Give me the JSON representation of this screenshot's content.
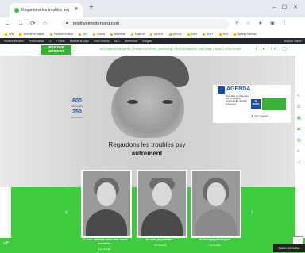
{
  "browser": {
    "tab_title": "Regardons les troubles psy au...",
    "tab_close": "×",
    "new_tab": "+",
    "window_buttons": "– ☐ ✕",
    "nav": {
      "back": "←",
      "forward": "→",
      "reload": "⟳",
      "home": "⌂"
    },
    "url": "positivemindersorg.com",
    "toolbar_icons": "⚲ ☆ ★ ▣ ⋮"
  },
  "bookmarks": [
    "WB",
    "Journées passé",
    "Retours mises",
    "BO",
    "Ouest",
    "Manette",
    "Mabrut",
    "AIDER",
    "ARON",
    "Lieu",
    "SNIT",
    "ROI",
    "Autres favoris"
  ],
  "admin_bar": {
    "items": [
      "Positive Minders",
      "Personnaliser",
      "0",
      "+ Créer",
      "Modifier la page",
      "Hotel Galerie",
      "SEO",
      "Référencer",
      "Insights"
    ],
    "right": "Bonjour, Admin"
  },
  "site": {
    "logo_line1": "POSITIVE",
    "logo_line2": "MINDERS",
    "menu": "ACCOMPAGNEMENT  |  PUBLICATIONS  |  AGENDA  |  TÉMOIGNAGES  |  MÉDIAS  |  SOIN  |  SOUTENIR",
    "social": "f ♥ in ◯"
  },
  "hero": {
    "stat1_num": "600",
    "stat1_label": "bénévoles",
    "stat2_num": "250",
    "stat2_label": "partenaires",
    "tagline_line1": "Regardons les troubles psy",
    "tagline_line2": "autrement"
  },
  "agenda": {
    "title": "AGENDA",
    "text": "Nous Mois de la Semaine info en 2023 info personnel des prochain évenement",
    "date": "18 MARS",
    "link": "▶ Voir l'agenda"
  },
  "sidebar_icons": [
    "<",
    "☰",
    "▦",
    "♟",
    "▤",
    "≡",
    "↗"
  ],
  "slider": {
    "prev": "‹",
    "next": "›",
    "cards": [
      {
        "caption": "Je suis atteinte dans ma santé mentale...",
        "link": "Lire la suite"
      },
      {
        "caption": "Je suis psychiatre...",
        "link": "Lire la suite"
      },
      {
        "caption": "Je suis psychologue",
        "link": "Lire la suite"
      }
    ]
  },
  "footer": {
    "wp": "wP",
    "cookie": "Gestion des cookies"
  }
}
